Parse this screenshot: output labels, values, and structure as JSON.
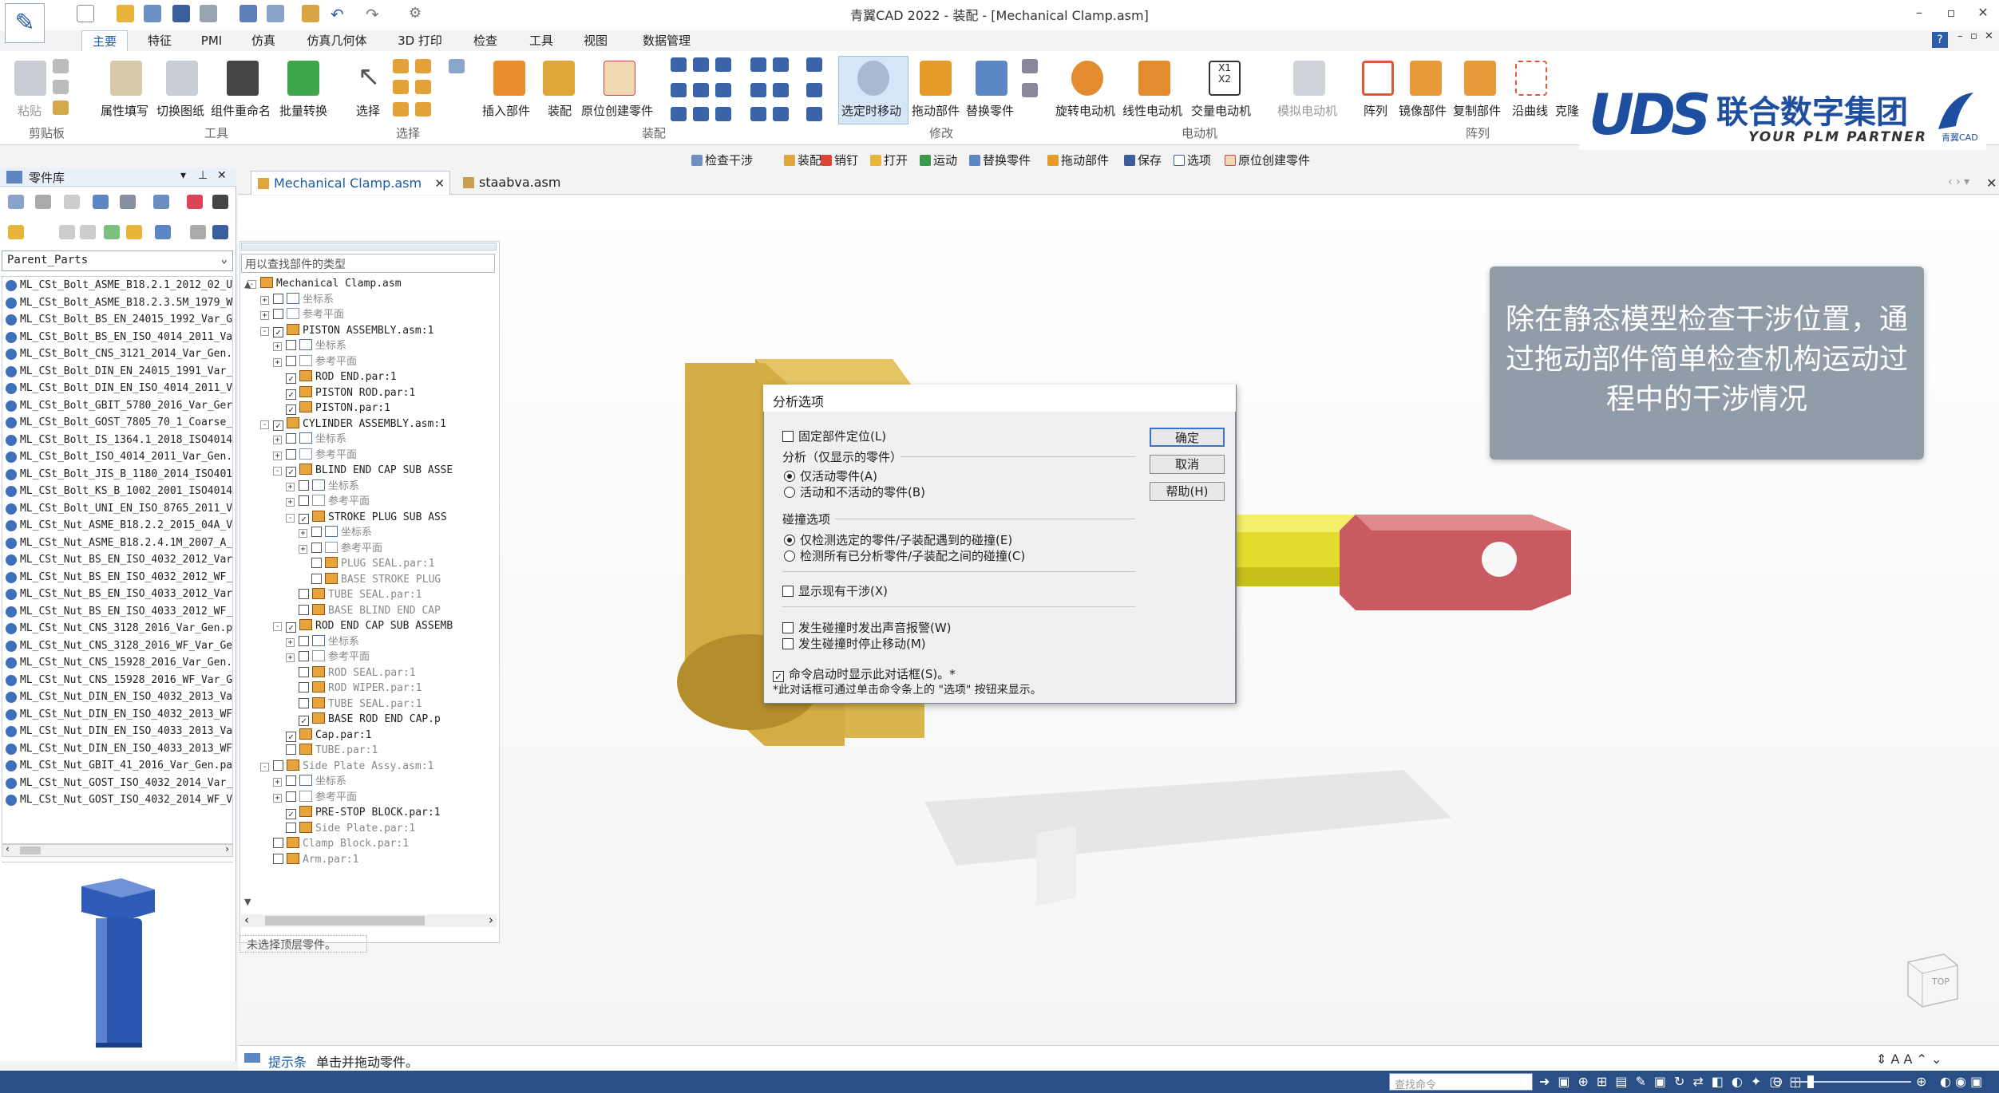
{
  "app": {
    "title": "青翼CAD 2022 - 装配 - [Mechanical Clamp.asm]"
  },
  "window_controls": [
    "–",
    "▫",
    "✕"
  ],
  "inner_window_controls": [
    "–",
    "▫",
    "✕"
  ],
  "ribbon_tabs": [
    "主要",
    "特征",
    "PMI",
    "仿真",
    "仿真几何体",
    "3D 打印",
    "检查",
    "工具",
    "视图",
    "数据管理"
  ],
  "ribbon": {
    "groups": [
      {
        "name": "剪贴板",
        "buttons": [
          "粘贴"
        ]
      },
      {
        "name": "工具",
        "buttons": [
          "属性填写",
          "切换图纸",
          "组件重命名",
          "批量转换"
        ]
      },
      {
        "name": "选择",
        "buttons": [
          "选择"
        ]
      },
      {
        "name": "装配",
        "buttons": [
          "插入部件",
          "装配",
          "原位创建零件"
        ]
      },
      {
        "name": "修改",
        "buttons": [
          "选定时移动",
          "拖动部件",
          "替换零件"
        ]
      },
      {
        "name": "电动机",
        "buttons": [
          "旋转电动机",
          "线性电动机",
          "交量电动机",
          "模拟电动机"
        ]
      },
      {
        "name": "阵列",
        "buttons": [
          "阵列",
          "镜像部件",
          "复制部件",
          "沿曲线",
          "克隆"
        ]
      }
    ]
  },
  "branding": {
    "logo": "UDS",
    "company": "联合数字集团",
    "tagline": "YOUR PLM PARTNER",
    "corner": "青翼CAD"
  },
  "command_bar": [
    "检查干涉",
    "装配",
    "销钉",
    "打开",
    "运动",
    "替换零件",
    "拖动部件",
    "保存",
    "选项",
    "原位创建零件"
  ],
  "left_panel": {
    "title": "零件库",
    "filter": "Parent_Parts",
    "parts": [
      "ML_CSt_Bolt_ASME_B18.2.1_2012_02_U",
      "ML_CSt_Bolt_ASME_B18.2.3.5M_1979_W",
      "ML_CSt_Bolt_BS_EN_24015_1992_Var_G",
      "ML_CSt_Bolt_BS_EN_ISO_4014_2011_Va",
      "ML_CSt_Bolt_CNS_3121_2014_Var_Gen.",
      "ML_CSt_Bolt_DIN_EN_24015_1991_Var_",
      "ML_CSt_Bolt_DIN_EN_ISO_4014_2011_V",
      "ML_CSt_Bolt_GBIT_5780_2016_Var_Ger",
      "ML_CSt_Bolt_GOST_7805_70_1_Coarse_",
      "ML_CSt_Bolt_IS_1364.1_2018_ISO4014",
      "ML_CSt_Bolt_ISO_4014_2011_Var_Gen.",
      "ML_CSt_Bolt_JIS_B_1180_2014_ISO401",
      "ML_CSt_Bolt_KS_B_1002_2001_ISO4014",
      "ML_CSt_Bolt_UNI_EN_ISO_8765_2011_V",
      "ML_CSt_Nut_ASME_B18.2.2_2015_04A_V",
      "ML_CSt_Nut_ASME_B18.2.4.1M_2007_A_",
      "ML_CSt_Nut_BS_EN_ISO_4032_2012_Var",
      "ML_CSt_Nut_BS_EN_ISO_4032_2012_WF_",
      "ML_CSt_Nut_BS_EN_ISO_4033_2012_Var",
      "ML_CSt_Nut_BS_EN_ISO_4033_2012_WF_",
      "ML_CSt_Nut_CNS_3128_2016_Var_Gen.p",
      "ML_CSt_Nut_CNS_3128_2016_WF_Var_Ge",
      "ML_CSt_Nut_CNS_15928_2016_Var_Gen.",
      "ML_CSt_Nut_CNS_15928_2016_WF_Var_G",
      "ML_CSt_Nut_DIN_EN_ISO_4032_2013_Va",
      "ML_CSt_Nut_DIN_EN_ISO_4032_2013_WF",
      "ML_CSt_Nut_DIN_EN_ISO_4033_2013_Va",
      "ML_CSt_Nut_DIN_EN_ISO_4033_2013_WF",
      "ML_CSt_Nut_GBIT_41_2016_Var_Gen.pa",
      "ML_CSt_Nut_GOST_ISO_4032_2014_Var_",
      "ML_CSt_Nut_GOST_ISO_4032_2014_WF_V"
    ]
  },
  "doc_tabs": [
    "Mechanical Clamp.asm",
    "staabva.asm"
  ],
  "pathfinder": {
    "search_placeholder": "用以查找部件的类型",
    "status": "未选择顶层零件。"
  },
  "callout": "除在静态模型检查干涉位置，通过拖动部件简单检查机构运动过程中的干涉情况",
  "dialog": {
    "title": "分析选项",
    "fixed_position": "固定部件定位(L)",
    "analysis_group": "分析（仅显示的零件）",
    "radio_active_only": "仅活动零件(A)",
    "radio_active_inactive": "活动和不活动的零件(B)",
    "collision_group": "碰撞选项",
    "radio_selected": "仅检测选定的零件/子装配遇到的碰撞(E)",
    "radio_all": "检测所有已分析零件/子装配之间的碰撞(C)",
    "show_existing": "显示现有干涉(X)",
    "beep": "发生碰撞时发出声音报警(W)",
    "stop": "发生碰撞时停止移动(M)",
    "show_dialog": "命令启动时显示此对话框(S)。*",
    "footnote": "*此对话框可通过单击命令条上的 \"选项\" 按钮来显示。",
    "ok": "确定",
    "cancel": "取消",
    "help": "帮助(H)"
  },
  "status_bar": {
    "label": "提示条",
    "text": "单击并拖动零件。",
    "find_placeholder": "查找命令"
  },
  "tree": [
    {
      "label": "Mechanical Clamp.asm",
      "depth": 0,
      "icon": "asm",
      "expander": "-",
      "checked": null,
      "gray": false
    },
    {
      "label": "坐标系",
      "depth": 1,
      "icon": "cs",
      "expander": "+",
      "checked": false,
      "gray": true
    },
    {
      "label": "参考平面",
      "depth": 1,
      "icon": "ref",
      "expander": "+",
      "checked": false,
      "gray": true
    },
    {
      "label": "PISTON ASSEMBLY.asm:1",
      "depth": 1,
      "icon": "asm",
      "expander": "-",
      "checked": true,
      "gray": false
    },
    {
      "label": "坐标系",
      "depth": 2,
      "icon": "cs",
      "expander": "+",
      "checked": false,
      "gray": true
    },
    {
      "label": "参考平面",
      "depth": 2,
      "icon": "ref",
      "expander": "+",
      "checked": false,
      "gray": true
    },
    {
      "label": "ROD END.par:1",
      "depth": 2,
      "icon": "par",
      "expander": "",
      "checked": true,
      "gray": false
    },
    {
      "label": "PISTON ROD.par:1",
      "depth": 2,
      "icon": "par",
      "expander": "",
      "checked": true,
      "gray": false
    },
    {
      "label": "PISTON.par:1",
      "depth": 2,
      "icon": "par",
      "expander": "",
      "checked": true,
      "gray": false
    },
    {
      "label": "CYLINDER ASSEMBLY.asm:1",
      "depth": 1,
      "icon": "asm",
      "expander": "-",
      "checked": true,
      "gray": false
    },
    {
      "label": "坐标系",
      "depth": 2,
      "icon": "cs",
      "expander": "+",
      "checked": false,
      "gray": true
    },
    {
      "label": "参考平面",
      "depth": 2,
      "icon": "ref",
      "expander": "+",
      "checked": false,
      "gray": true
    },
    {
      "label": "BLIND END CAP SUB ASSE",
      "depth": 2,
      "icon": "asm",
      "expander": "-",
      "checked": true,
      "gray": false
    },
    {
      "label": "坐标系",
      "depth": 3,
      "icon": "cs",
      "expander": "+",
      "checked": false,
      "gray": true
    },
    {
      "label": "参考平面",
      "depth": 3,
      "icon": "ref",
      "expander": "+",
      "checked": false,
      "gray": true
    },
    {
      "label": "STROKE PLUG SUB ASS",
      "depth": 3,
      "icon": "asm",
      "expander": "-",
      "checked": true,
      "gray": false
    },
    {
      "label": "坐标系",
      "depth": 4,
      "icon": "cs",
      "expander": "+",
      "checked": false,
      "gray": true
    },
    {
      "label": "参考平面",
      "depth": 4,
      "icon": "ref",
      "expander": "+",
      "checked": false,
      "gray": true
    },
    {
      "label": "PLUG SEAL.par:1",
      "depth": 4,
      "icon": "par",
      "expander": "",
      "checked": false,
      "gray": true
    },
    {
      "label": "BASE STROKE PLUG",
      "depth": 4,
      "icon": "par",
      "expander": "",
      "checked": false,
      "gray": true
    },
    {
      "label": "TUBE SEAL.par:1",
      "depth": 3,
      "icon": "par",
      "expander": "",
      "checked": false,
      "gray": true
    },
    {
      "label": "BASE BLIND END CAP",
      "depth": 3,
      "icon": "par",
      "expander": "",
      "checked": false,
      "gray": true
    },
    {
      "label": "ROD END CAP SUB ASSEMB",
      "depth": 2,
      "icon": "asm",
      "expander": "-",
      "checked": true,
      "gray": false
    },
    {
      "label": "坐标系",
      "depth": 3,
      "icon": "cs",
      "expander": "+",
      "checked": false,
      "gray": true
    },
    {
      "label": "参考平面",
      "depth": 3,
      "icon": "ref",
      "expander": "+",
      "checked": false,
      "gray": true
    },
    {
      "label": "ROD SEAL.par:1",
      "depth": 3,
      "icon": "par",
      "expander": "",
      "checked": false,
      "gray": true
    },
    {
      "label": "ROD WIPER.par:1",
      "depth": 3,
      "icon": "par",
      "expander": "",
      "checked": false,
      "gray": true
    },
    {
      "label": "TUBE SEAL.par:1",
      "depth": 3,
      "icon": "par",
      "expander": "",
      "checked": false,
      "gray": true
    },
    {
      "label": "BASE ROD END CAP.p",
      "depth": 3,
      "icon": "par",
      "expander": "",
      "checked": true,
      "gray": false
    },
    {
      "label": "Cap.par:1",
      "depth": 2,
      "icon": "par",
      "expander": "",
      "checked": true,
      "gray": false
    },
    {
      "label": "TUBE.par:1",
      "depth": 2,
      "icon": "par",
      "expander": "",
      "checked": false,
      "gray": true
    },
    {
      "label": "Side Plate Assy.asm:1",
      "depth": 1,
      "icon": "asm",
      "expander": "-",
      "checked": false,
      "gray": true
    },
    {
      "label": "坐标系",
      "depth": 2,
      "icon": "cs",
      "expander": "+",
      "checked": false,
      "gray": true
    },
    {
      "label": "参考平面",
      "depth": 2,
      "icon": "ref",
      "expander": "+",
      "checked": false,
      "gray": true
    },
    {
      "label": "PRE-STOP BLOCK.par:1",
      "depth": 2,
      "icon": "par",
      "expander": "",
      "checked": true,
      "gray": false
    },
    {
      "label": "Side Plate.par:1",
      "depth": 2,
      "icon": "par",
      "expander": "",
      "checked": false,
      "gray": true
    },
    {
      "label": "Clamp Block.par:1",
      "depth": 1,
      "icon": "par",
      "expander": "",
      "checked": false,
      "gray": true
    },
    {
      "label": "Arm.par:1",
      "depth": 1,
      "icon": "par",
      "expander": "",
      "checked": false,
      "gray": true
    }
  ]
}
